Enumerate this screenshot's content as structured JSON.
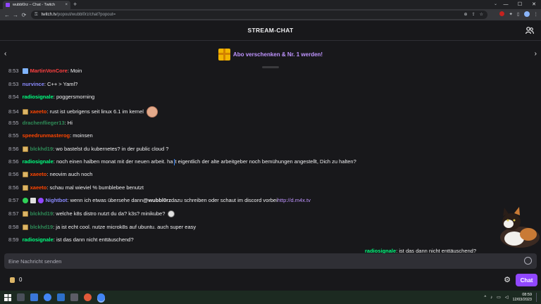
{
  "browser": {
    "tab_title": "wubbl0rz – Chat - Twitch",
    "tab_close": "×",
    "new_tab": "+",
    "url_host": "twitch.tv",
    "url_path": "/popout/wubbl0rz/chat?popout=",
    "window_controls": [
      "—",
      "☐",
      "✕"
    ]
  },
  "chat_header": {
    "title": "STREAM-CHAT"
  },
  "gift_banner": {
    "text": "Abo verschenken & Nr. 1 werden!",
    "prev": "‹",
    "next": "›"
  },
  "messages": [
    {
      "time": "8:53",
      "user": "MartinVonCore",
      "color": "#ff4040",
      "text": ": Moin",
      "badges": [
        "badge-blue"
      ]
    },
    {
      "time": "8:53",
      "user": "nurvince",
      "color": "#8a8aff",
      "text": ": C++ > Yaml?",
      "badges": []
    },
    {
      "time": "8:54",
      "user": "radiosignale",
      "color": "#00ff7f",
      "text": ": poggersmorning",
      "badges": []
    },
    {
      "time": "8:54",
      "user": "xaeeto",
      "color": "#ff4500",
      "text": ": rust ist uebrigens seit linux 6.1 im kernel",
      "badges": [
        "badge-smile"
      ],
      "emote": "face"
    },
    {
      "time": "8:55",
      "user": "drachenflieger13",
      "color": "#2e8b57",
      "text": ": Hi",
      "badges": []
    },
    {
      "time": "8:55",
      "user": "speedrunmasterog",
      "color": "#ff4500",
      "text": ": moinsen",
      "badges": []
    },
    {
      "time": "8:56",
      "user": "blckhd19",
      "color": "#2e8b57",
      "text": ": wo bastelst du kubernetes? in der public cloud ?",
      "badges": [
        "badge-smile"
      ]
    },
    {
      "time": "8:56",
      "user": "radiosignale",
      "color": "#00ff7f",
      "text": ": noch einen halben monat mit der neuen arbeit. ha",
      "text2": "t eigentlich der alte arbeitgeber noch bemühungen angestellt, Dich zu halten?",
      "badges": [],
      "cursor": true
    },
    {
      "time": "8:56",
      "user": "xaeeto",
      "color": "#ff4500",
      "text": ": neovim auch noch",
      "badges": [
        "badge-smile"
      ]
    },
    {
      "time": "8:56",
      "user": "xaeeto",
      "color": "#ff4500",
      "text": ": schau mal wieviel % bumblebee benutzt",
      "badges": [
        "badge-smile"
      ]
    },
    {
      "time": "8:57",
      "user": "Nightbot",
      "color": "#8a8aff",
      "text": ": wenn ich etwas übersehe dann ",
      "mention": "@wubbl0rz",
      "text2": " dazu schreiben oder schaut im discord vorbei ",
      "link": "http://d.m4x.tv",
      "badges": [
        "badge-green",
        "badge-crown",
        "badge-verified"
      ]
    },
    {
      "time": "8:57",
      "user": "blckhd19",
      "color": "#2e8b57",
      "text": ": welche k8s distro nutzt du da? k3s? minikube?",
      "badges": [
        "badge-smile"
      ],
      "emote": "skull"
    },
    {
      "time": "8:58",
      "user": "blckhd19",
      "color": "#2e8b57",
      "text": ": ja ist echt cool. nutze microk8s auf ubuntu. auch super easy",
      "badges": [
        "badge-smile"
      ]
    },
    {
      "time": "8:59",
      "user": "radiosignale",
      "color": "#00ff7f",
      "text": ": ist das dann nicht enttäuschend?",
      "badges": []
    }
  ],
  "overlay": {
    "user": "radiosignale",
    "text": ": ist das dann nicht enttäuschend?"
  },
  "input": {
    "placeholder": "Eine Nachricht senden"
  },
  "footer": {
    "points": "0",
    "chat_button": "Chat",
    "settings_icon": "⚙"
  },
  "taskbar": {
    "time": "08:59",
    "date": "12/03/2023",
    "tray_up": "^"
  },
  "icons": {
    "back": "←",
    "forward": "→",
    "reload": "⟳",
    "lock": "🔒",
    "star": "☆",
    "share": "⇪",
    "zoom": "⊕",
    "puzzle": "✦",
    "menu": "⋮"
  },
  "colors": {
    "accent": "#9147ff",
    "link": "#bf94ff",
    "background": "#18181b"
  }
}
